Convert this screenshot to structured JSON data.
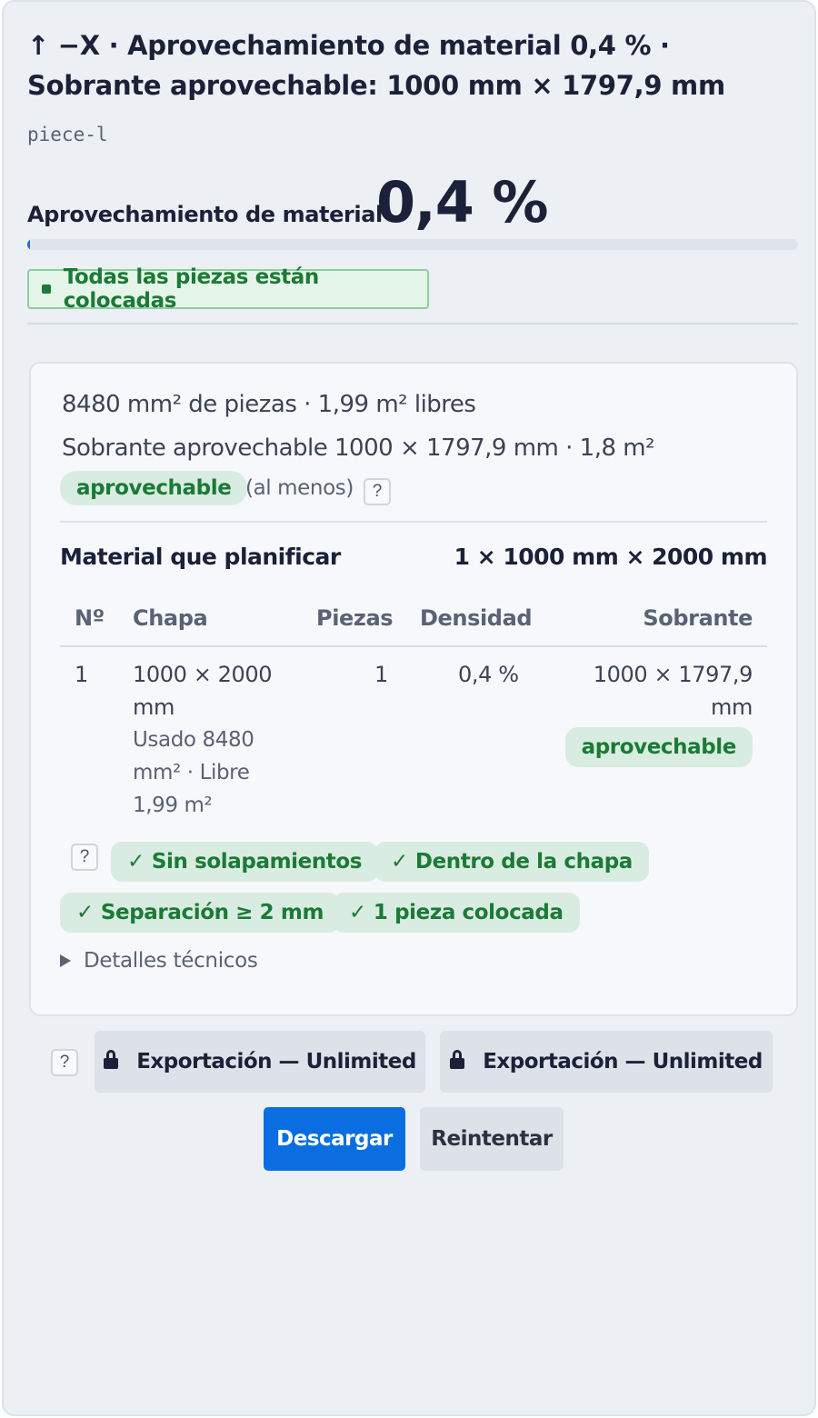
{
  "header": {
    "title": "↑ −X · Aprovechamiento de material 0,4 % · Sobrante aprovechable: 1000 mm × 1797,9 mm",
    "id": "piece-l"
  },
  "metric": {
    "label": "Aprovechamiento de material",
    "value": "0,4 %",
    "progress_percent": 0.4,
    "progress_color": "#1a6fe0"
  },
  "status": {
    "text": "Todas las piezas están colocadas",
    "color": "#1b7a36"
  },
  "summary": {
    "line1": "8480 mm² de piezas · 1,99 m² libres",
    "line2": "Sobrante aprovechable 1000 × 1797,9 mm · 1,8 m²",
    "tag": "aprovechable",
    "qualifier": "(al menos)",
    "help": "?"
  },
  "plan": {
    "label": "Material que planificar",
    "value": "1 × 1000 mm × 2000 mm"
  },
  "table": {
    "headers": [
      "Nº",
      "Chapa",
      "Piezas",
      "Densidad",
      "Sobrante"
    ],
    "rows": [
      {
        "n": "1",
        "sheet": "1000 × 2000 mm",
        "sheet_detail": "Usado 8480 mm² · Libre 1,99 m²",
        "pieces": "1",
        "density": "0,4 %",
        "leftover": "1000 × 1797,9 mm",
        "leftover_tag": "aprovechable"
      }
    ]
  },
  "checks": {
    "help": "?",
    "items": [
      "Sin solapamientos",
      "Dentro de la chapa",
      "Separación ≥ 2 mm",
      "1 pieza colocada"
    ],
    "check_icon": "checkmark-icon"
  },
  "details_toggle": "Detalles técnicos",
  "export": {
    "help": "?",
    "button1": "Exportación — Unlimited",
    "button2": "Exportación — Unlimited",
    "icon": "lock-icon"
  },
  "actions": {
    "primary": "Descargar",
    "secondary": "Reintentar",
    "primary_color": "#0a6ee0"
  }
}
